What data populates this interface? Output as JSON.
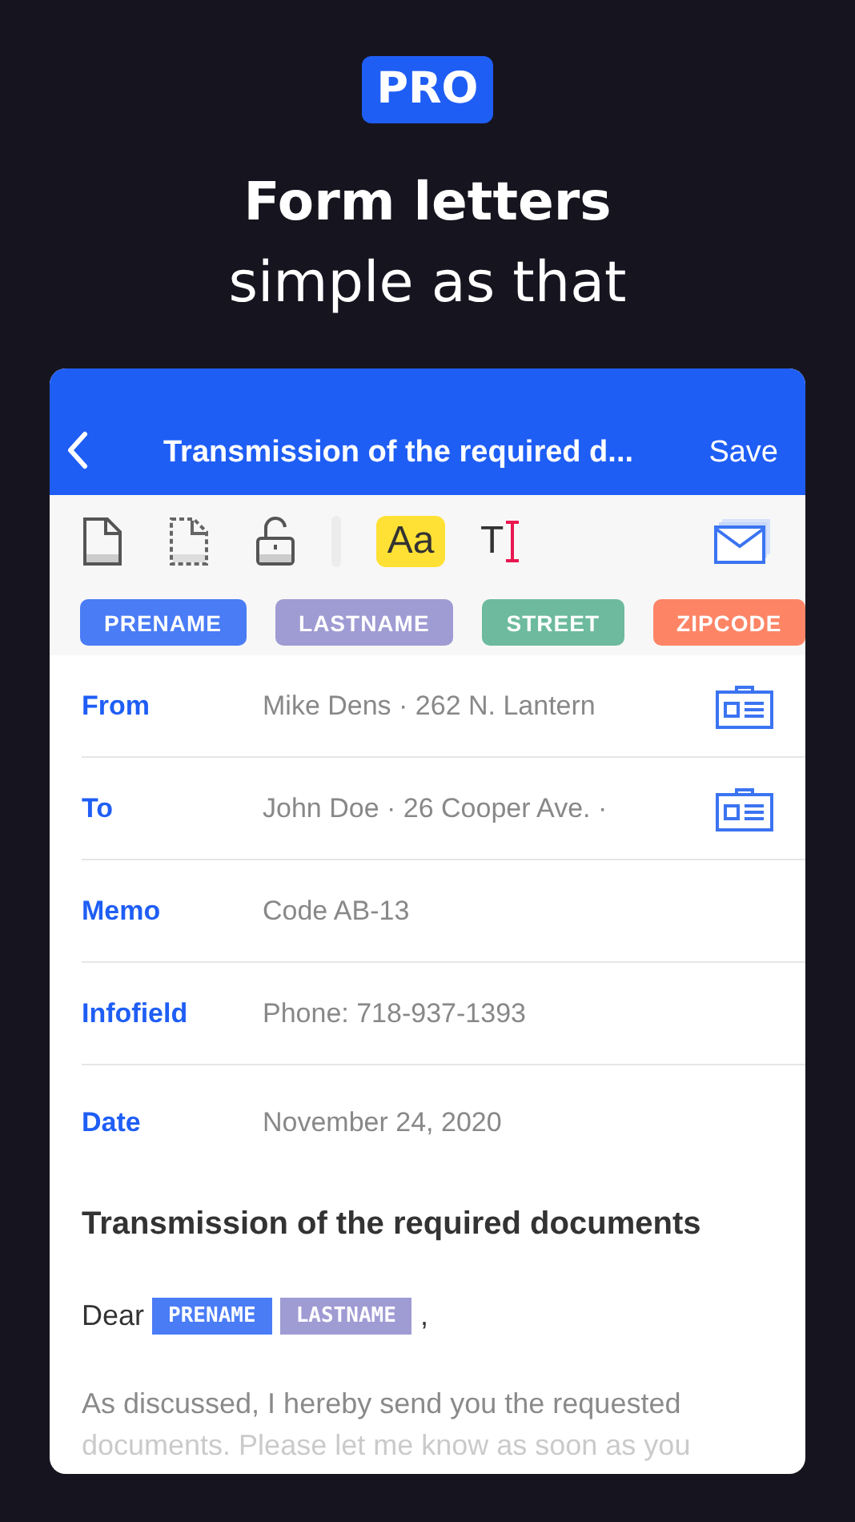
{
  "badge": "PRO",
  "headline": "Form letters",
  "subheadline": "simple as that",
  "nav": {
    "title": "Transmission of the required d...",
    "action": "Save"
  },
  "toolbar": [
    {
      "kind": "document",
      "selected": false
    },
    {
      "kind": "dashed-document",
      "selected": false
    },
    {
      "kind": "unlock",
      "selected": false
    },
    {
      "kind": "font",
      "label": "Aa",
      "selected": true
    },
    {
      "kind": "text-cursor",
      "label": "T",
      "selected": false
    },
    {
      "kind": "mail",
      "selected": false
    }
  ],
  "tags": [
    {
      "label": "PRENAME",
      "color": "#4a7cf6"
    },
    {
      "label": "LASTNAME",
      "color": "#9f9bd3"
    },
    {
      "label": "STREET",
      "color": "#6dba9e"
    },
    {
      "label": "ZIPCODE",
      "color": "#fd8566"
    }
  ],
  "fields": [
    {
      "label": "From",
      "value": "Mike Dens · 262 N. Lantern",
      "contact": true
    },
    {
      "label": "To",
      "value": "John Doe · 26 Cooper Ave. ·",
      "contact": true
    },
    {
      "label": "Memo",
      "value": "Code AB-13",
      "contact": false
    },
    {
      "label": "Infofield",
      "value": "Phone: 718-937-1393",
      "contact": false
    },
    {
      "label": "Date",
      "value": "November 24, 2020",
      "contact": false
    }
  ],
  "letter": {
    "subject": "Transmission of the required documents",
    "salutation": [
      {
        "kind": "text",
        "text": "Dear"
      },
      {
        "kind": "token",
        "text": "PRENAME",
        "color": "#4a7cf6"
      },
      {
        "kind": "token",
        "text": "LASTNAME",
        "color": "#9f9bd3"
      },
      {
        "kind": "text",
        "text": ","
      }
    ],
    "body": "As discussed, I hereby send you the requested documents. Please let me know as soon as you"
  }
}
